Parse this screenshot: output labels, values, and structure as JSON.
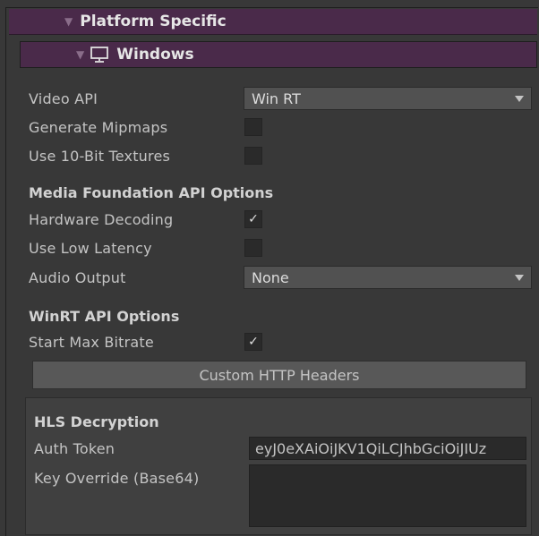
{
  "platform_header": {
    "title": "Platform Specific",
    "arrow": "▼"
  },
  "windows_header": {
    "title": "Windows",
    "arrow": "▼",
    "icon": "monitor-icon"
  },
  "video_api": {
    "label": "Video API",
    "value": "Win RT"
  },
  "generate_mipmaps": {
    "label": "Generate Mipmaps",
    "checked": false
  },
  "use_10bit": {
    "label": "Use 10-Bit Textures",
    "checked": false
  },
  "media_foundation": {
    "section_title": "Media Foundation API Options"
  },
  "hardware_decoding": {
    "label": "Hardware Decoding",
    "checked": true,
    "check_glyph": "✓"
  },
  "low_latency": {
    "label": "Use Low Latency",
    "checked": false
  },
  "audio_output": {
    "label": "Audio Output",
    "value": "None"
  },
  "winrt": {
    "section_title": "WinRT API Options"
  },
  "start_max_bitrate": {
    "label": "Start Max Bitrate",
    "checked": true,
    "check_glyph": "✓"
  },
  "custom_http_headers": {
    "label": "Custom HTTP Headers"
  },
  "hls_decryption": {
    "section_title": "HLS Decryption",
    "auth_token_label": "Auth Token",
    "auth_token_value": "eyJ0eXAiOiJKV1QiLCJhbGciOiJIUz",
    "key_override_label": "Key Override (Base64)",
    "key_override_value": ""
  }
}
